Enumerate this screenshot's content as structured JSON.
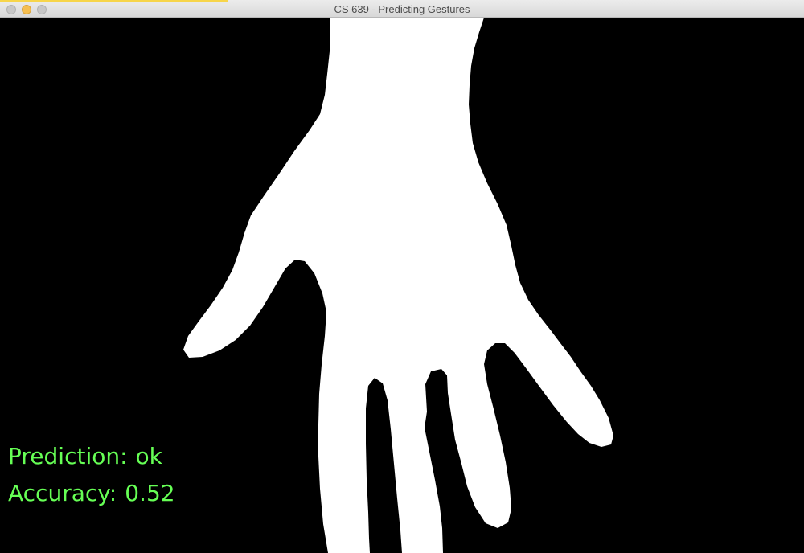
{
  "window": {
    "title": "CS 639 - Predicting Gestures"
  },
  "overlay": {
    "prediction_label": "Prediction:",
    "prediction_value": "ok",
    "accuracy_label": "Accuracy:",
    "accuracy_value": "0.52"
  },
  "colors": {
    "background": "#000000",
    "mask": "#ffffff",
    "overlay_text": "#66ff55"
  },
  "icons": {
    "close": "close-icon",
    "minimize": "minimize-icon",
    "zoom": "zoom-icon"
  }
}
